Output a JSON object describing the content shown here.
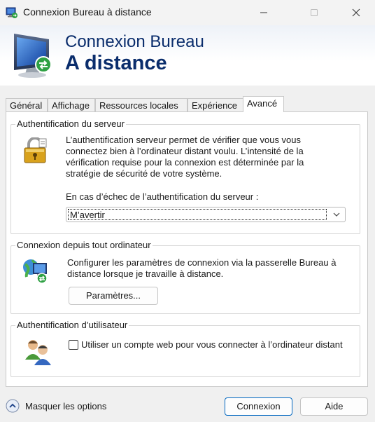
{
  "window": {
    "title": "Connexion Bureau à distance"
  },
  "banner": {
    "line1": "Connexion Bureau",
    "line2": "A distance"
  },
  "tabs": [
    {
      "label": "Général"
    },
    {
      "label": "Affichage"
    },
    {
      "label": "Ressources locales"
    },
    {
      "label": "Expérience"
    },
    {
      "label": "Avancé",
      "active": true
    }
  ],
  "server_auth": {
    "title": "Authentification du serveur",
    "description": [
      "L’authentification serveur permet de vérifier que vous vous",
      "connectez bien à l’ordinateur distant voulu. L’intensité de la",
      "vérification requise pour la connexion est déterminée par la",
      "stratégie de sécurité de votre système."
    ],
    "failure_label": "En cas d’échec de l’authentification du serveur :",
    "failure_selected": "M’avertir"
  },
  "connect_anywhere": {
    "title": "Connexion depuis tout ordinateur",
    "description": [
      "Configurer les paramètres de connexion via la passerelle Bureau à",
      "distance lorsque je travaille à distance."
    ],
    "settings_button": "Paramètres..."
  },
  "user_auth": {
    "title": "Authentification d’utilisateur",
    "checkbox_label": "Utiliser un compte web pour vous connecter à l’ordinateur distant",
    "checked": false
  },
  "footer": {
    "hide_options": "Masquer les options",
    "connect_button": "Connexion",
    "help_button": "Aide"
  },
  "colors": {
    "banner_text": "#0a2d6c",
    "primary_border": "#0067c0"
  }
}
